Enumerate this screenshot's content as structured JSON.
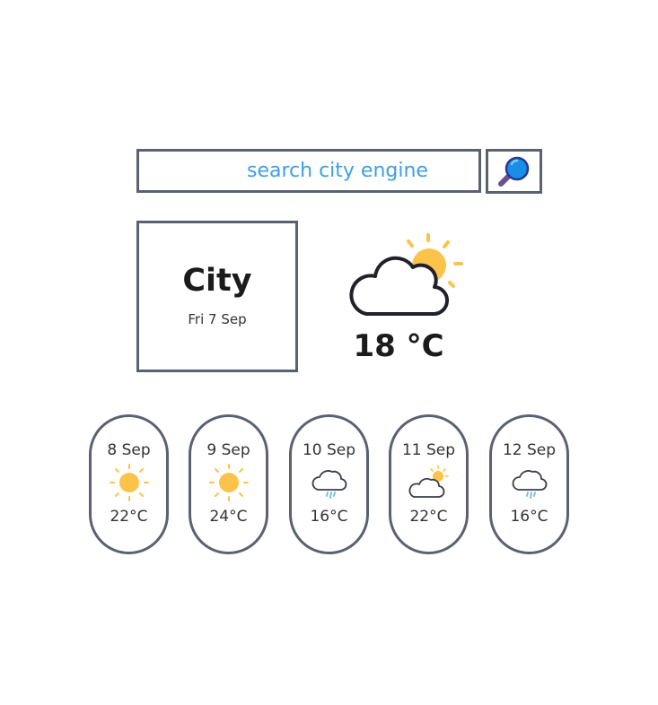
{
  "search": {
    "placeholder": "search city engine",
    "button_icon": "magnifier-icon"
  },
  "current": {
    "city": "City",
    "date": "Fri 7 Sep",
    "temperature": "18 °C",
    "icon": "partly-cloudy-icon"
  },
  "forecast": [
    {
      "date": "8 Sep",
      "temp": "22°C",
      "icon": "sun-icon"
    },
    {
      "date": "9 Sep",
      "temp": "24°C",
      "icon": "sun-icon"
    },
    {
      "date": "10 Sep",
      "temp": "16°C",
      "icon": "rain-cloud-icon"
    },
    {
      "date": "11 Sep",
      "temp": "22°C",
      "icon": "partly-cloudy-icon"
    },
    {
      "date": "12 Sep",
      "temp": "16°C",
      "icon": "rain-cloud-icon"
    }
  ],
  "colors": {
    "border": "#5a6272",
    "accent": "#3aa0ea",
    "sun": "#fcc34a",
    "rain": "#6fbbe0"
  }
}
